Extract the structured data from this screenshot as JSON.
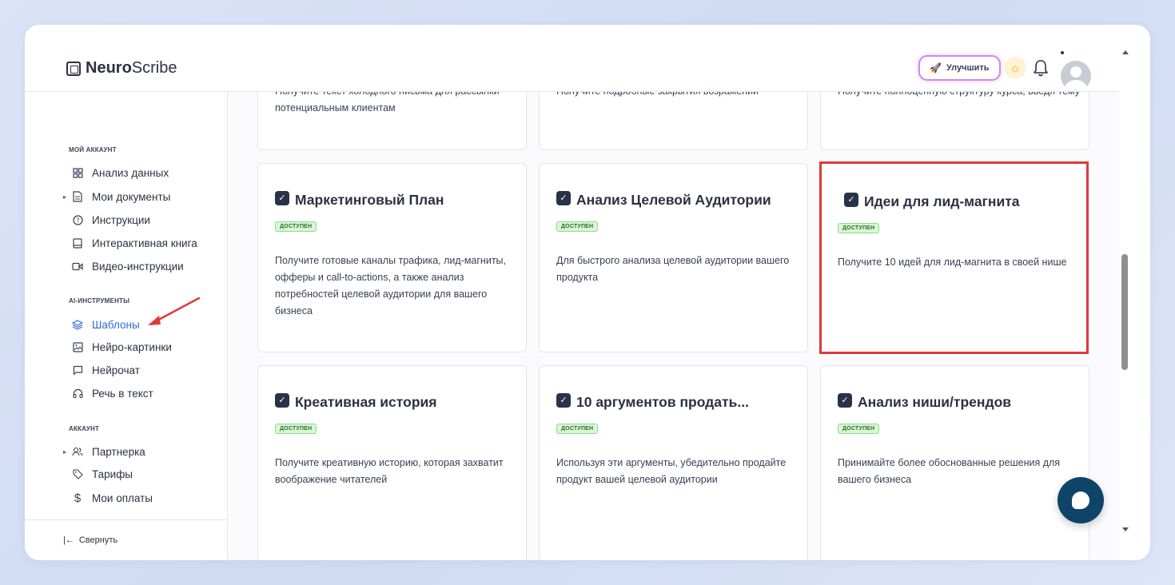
{
  "brand": {
    "name_bold": "Neuro",
    "name_rest": "Scribe"
  },
  "header": {
    "upgrade_label": "Улучшить"
  },
  "sidebar": {
    "sections": [
      {
        "title": "МОЙ АККАУНТ"
      },
      {
        "title": "AI-ИНСТРУМЕНТЫ"
      },
      {
        "title": "АККАУНТ"
      }
    ],
    "items": [
      {
        "label": "Анализ данных",
        "icon": "grid-icon"
      },
      {
        "label": "Мои документы",
        "icon": "document-icon"
      },
      {
        "label": "Инструкции",
        "icon": "help-circle-icon"
      },
      {
        "label": "Интерактивная книга",
        "icon": "book-icon"
      },
      {
        "label": "Видео-инструкции",
        "icon": "video-icon"
      },
      {
        "label": "Шаблоны",
        "icon": "layers-icon"
      },
      {
        "label": "Нейро-картинки",
        "icon": "image-icon"
      },
      {
        "label": "Нейрочат",
        "icon": "chat-icon"
      },
      {
        "label": "Речь в текст",
        "icon": "headphones-icon"
      },
      {
        "label": "Партнерка",
        "icon": "users-icon"
      },
      {
        "label": "Тарифы",
        "icon": "tag-icon"
      },
      {
        "label": "Мои оплаты",
        "icon": "dollar-icon"
      }
    ],
    "collapse_label": "Свернуть"
  },
  "cards_top": [
    {
      "desc": "Получите текст холодного письма для рассылки потенциальным клиентам"
    },
    {
      "desc": "Получите подробные закрытия возражений"
    },
    {
      "desc": "Получите полноценную структуру курса, введя тему"
    }
  ],
  "cards": [
    {
      "title": "Маркетинговый План",
      "badge": "ДОСТУПЕН",
      "desc": "Получите готовые каналы трафика, лид-магниты, офферы и call-to-actions, а также анализ потребностей целевой аудитории для вашего бизнеса"
    },
    {
      "title": "Анализ Целевой Аудитории",
      "badge": "ДОСТУПЕН",
      "desc": "Для быстрого анализа целевой аудитории вашего продукта"
    },
    {
      "title": "Идеи для лид-магнита",
      "badge": "ДОСТУПЕН",
      "desc": "Получите 10 идей для лид-магнита в своей нише"
    },
    {
      "title": "Креативная история",
      "badge": "ДОСТУПЕН",
      "desc": "Получите креативную историю, которая захватит воображение читателей"
    },
    {
      "title": "10 аргументов продать...",
      "badge": "ДОСТУПЕН",
      "desc": "Используя эти аргументы, убедительно продайте продукт вашей целевой аудитории"
    },
    {
      "title": "Анализ ниши/трендов",
      "badge": "ДОСТУПЕН",
      "desc": "Принимайте более обоснованные решения для вашего бизнеса"
    }
  ],
  "colors": {
    "accent": "#2d6ad8",
    "highlight": "#e0393b",
    "badge_bg": "#d9f7d4",
    "chat": "#0e4468"
  }
}
